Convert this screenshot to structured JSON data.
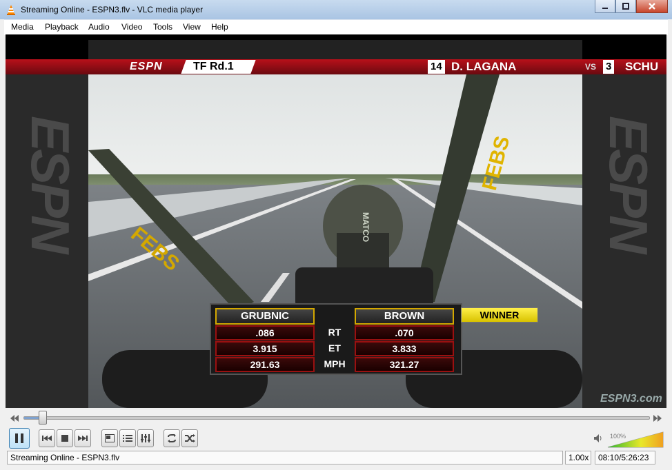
{
  "window": {
    "title": "Streaming Online  - ESPN3.flv - VLC media player"
  },
  "menu": [
    "Media",
    "Playback",
    "Audio",
    "Video",
    "Tools",
    "View",
    "Help"
  ],
  "overlay": {
    "network": "ESPN",
    "race": "TF Rd.1",
    "lane1_number": "14",
    "lane1_driver": "D. LAGANA",
    "vs": "VS",
    "lane2_number": "3",
    "lane2_driver": "SCHU",
    "watermark": "ESPN3.com"
  },
  "scoreboard": {
    "left_driver": "GRUBNIC",
    "right_driver": "BROWN",
    "winner_label": "WINNER",
    "rows": [
      {
        "label": "RT",
        "left": ".086",
        "right": ".070"
      },
      {
        "label": "ET",
        "left": "3.915",
        "right": "3.833"
      },
      {
        "label": "MPH",
        "left": "291.63",
        "right": "321.27"
      }
    ]
  },
  "playback": {
    "progress_fraction": 0.03
  },
  "volume": {
    "percent": "100%",
    "level_fraction": 1.0
  },
  "status": {
    "text": "Streaming Online  - ESPN3.flv",
    "speed": "1.00x",
    "time": "08:10/5:26:23"
  },
  "icons": {
    "pause": "pause-icon",
    "previous": "previous-icon",
    "stop": "stop-icon",
    "next": "next-icon",
    "fullscreen": "fullscreen-icon",
    "playlist": "playlist-icon",
    "extended": "extended-settings-icon",
    "loop": "loop-icon",
    "shuffle": "shuffle-icon",
    "volume": "speaker-icon"
  }
}
